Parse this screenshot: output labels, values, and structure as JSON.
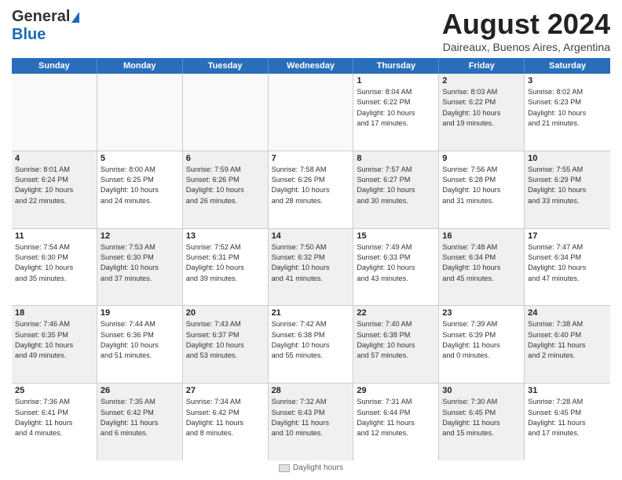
{
  "logo": {
    "line1": "General",
    "line2": "Blue"
  },
  "title": {
    "month_year": "August 2024",
    "location": "Daireaux, Buenos Aires, Argentina"
  },
  "weekdays": [
    "Sunday",
    "Monday",
    "Tuesday",
    "Wednesday",
    "Thursday",
    "Friday",
    "Saturday"
  ],
  "rows": [
    [
      {
        "day": "",
        "info": "",
        "shaded": false,
        "empty": true
      },
      {
        "day": "",
        "info": "",
        "shaded": false,
        "empty": true
      },
      {
        "day": "",
        "info": "",
        "shaded": false,
        "empty": true
      },
      {
        "day": "",
        "info": "",
        "shaded": false,
        "empty": true
      },
      {
        "day": "1",
        "info": "Sunrise: 8:04 AM\nSunset: 6:22 PM\nDaylight: 10 hours\nand 17 minutes.",
        "shaded": false,
        "empty": false
      },
      {
        "day": "2",
        "info": "Sunrise: 8:03 AM\nSunset: 6:22 PM\nDaylight: 10 hours\nand 19 minutes.",
        "shaded": true,
        "empty": false
      },
      {
        "day": "3",
        "info": "Sunrise: 8:02 AM\nSunset: 6:23 PM\nDaylight: 10 hours\nand 21 minutes.",
        "shaded": false,
        "empty": false
      }
    ],
    [
      {
        "day": "4",
        "info": "Sunrise: 8:01 AM\nSunset: 6:24 PM\nDaylight: 10 hours\nand 22 minutes.",
        "shaded": true,
        "empty": false
      },
      {
        "day": "5",
        "info": "Sunrise: 8:00 AM\nSunset: 6:25 PM\nDaylight: 10 hours\nand 24 minutes.",
        "shaded": false,
        "empty": false
      },
      {
        "day": "6",
        "info": "Sunrise: 7:59 AM\nSunset: 6:26 PM\nDaylight: 10 hours\nand 26 minutes.",
        "shaded": true,
        "empty": false
      },
      {
        "day": "7",
        "info": "Sunrise: 7:58 AM\nSunset: 6:26 PM\nDaylight: 10 hours\nand 28 minutes.",
        "shaded": false,
        "empty": false
      },
      {
        "day": "8",
        "info": "Sunrise: 7:57 AM\nSunset: 6:27 PM\nDaylight: 10 hours\nand 30 minutes.",
        "shaded": true,
        "empty": false
      },
      {
        "day": "9",
        "info": "Sunrise: 7:56 AM\nSunset: 6:28 PM\nDaylight: 10 hours\nand 31 minutes.",
        "shaded": false,
        "empty": false
      },
      {
        "day": "10",
        "info": "Sunrise: 7:55 AM\nSunset: 6:29 PM\nDaylight: 10 hours\nand 33 minutes.",
        "shaded": true,
        "empty": false
      }
    ],
    [
      {
        "day": "11",
        "info": "Sunrise: 7:54 AM\nSunset: 6:30 PM\nDaylight: 10 hours\nand 35 minutes.",
        "shaded": false,
        "empty": false
      },
      {
        "day": "12",
        "info": "Sunrise: 7:53 AM\nSunset: 6:30 PM\nDaylight: 10 hours\nand 37 minutes.",
        "shaded": true,
        "empty": false
      },
      {
        "day": "13",
        "info": "Sunrise: 7:52 AM\nSunset: 6:31 PM\nDaylight: 10 hours\nand 39 minutes.",
        "shaded": false,
        "empty": false
      },
      {
        "day": "14",
        "info": "Sunrise: 7:50 AM\nSunset: 6:32 PM\nDaylight: 10 hours\nand 41 minutes.",
        "shaded": true,
        "empty": false
      },
      {
        "day": "15",
        "info": "Sunrise: 7:49 AM\nSunset: 6:33 PM\nDaylight: 10 hours\nand 43 minutes.",
        "shaded": false,
        "empty": false
      },
      {
        "day": "16",
        "info": "Sunrise: 7:48 AM\nSunset: 6:34 PM\nDaylight: 10 hours\nand 45 minutes.",
        "shaded": true,
        "empty": false
      },
      {
        "day": "17",
        "info": "Sunrise: 7:47 AM\nSunset: 6:34 PM\nDaylight: 10 hours\nand 47 minutes.",
        "shaded": false,
        "empty": false
      }
    ],
    [
      {
        "day": "18",
        "info": "Sunrise: 7:46 AM\nSunset: 6:35 PM\nDaylight: 10 hours\nand 49 minutes.",
        "shaded": true,
        "empty": false
      },
      {
        "day": "19",
        "info": "Sunrise: 7:44 AM\nSunset: 6:36 PM\nDaylight: 10 hours\nand 51 minutes.",
        "shaded": false,
        "empty": false
      },
      {
        "day": "20",
        "info": "Sunrise: 7:43 AM\nSunset: 6:37 PM\nDaylight: 10 hours\nand 53 minutes.",
        "shaded": true,
        "empty": false
      },
      {
        "day": "21",
        "info": "Sunrise: 7:42 AM\nSunset: 6:38 PM\nDaylight: 10 hours\nand 55 minutes.",
        "shaded": false,
        "empty": false
      },
      {
        "day": "22",
        "info": "Sunrise: 7:40 AM\nSunset: 6:38 PM\nDaylight: 10 hours\nand 57 minutes.",
        "shaded": true,
        "empty": false
      },
      {
        "day": "23",
        "info": "Sunrise: 7:39 AM\nSunset: 6:39 PM\nDaylight: 11 hours\nand 0 minutes.",
        "shaded": false,
        "empty": false
      },
      {
        "day": "24",
        "info": "Sunrise: 7:38 AM\nSunset: 6:40 PM\nDaylight: 11 hours\nand 2 minutes.",
        "shaded": true,
        "empty": false
      }
    ],
    [
      {
        "day": "25",
        "info": "Sunrise: 7:36 AM\nSunset: 6:41 PM\nDaylight: 11 hours\nand 4 minutes.",
        "shaded": false,
        "empty": false
      },
      {
        "day": "26",
        "info": "Sunrise: 7:35 AM\nSunset: 6:42 PM\nDaylight: 11 hours\nand 6 minutes.",
        "shaded": true,
        "empty": false
      },
      {
        "day": "27",
        "info": "Sunrise: 7:34 AM\nSunset: 6:42 PM\nDaylight: 11 hours\nand 8 minutes.",
        "shaded": false,
        "empty": false
      },
      {
        "day": "28",
        "info": "Sunrise: 7:32 AM\nSunset: 6:43 PM\nDaylight: 11 hours\nand 10 minutes.",
        "shaded": true,
        "empty": false
      },
      {
        "day": "29",
        "info": "Sunrise: 7:31 AM\nSunset: 6:44 PM\nDaylight: 11 hours\nand 12 minutes.",
        "shaded": false,
        "empty": false
      },
      {
        "day": "30",
        "info": "Sunrise: 7:30 AM\nSunset: 6:45 PM\nDaylight: 11 hours\nand 15 minutes.",
        "shaded": true,
        "empty": false
      },
      {
        "day": "31",
        "info": "Sunrise: 7:28 AM\nSunset: 6:45 PM\nDaylight: 11 hours\nand 17 minutes.",
        "shaded": false,
        "empty": false
      }
    ]
  ],
  "footer": {
    "legend_label": "Daylight hours"
  }
}
